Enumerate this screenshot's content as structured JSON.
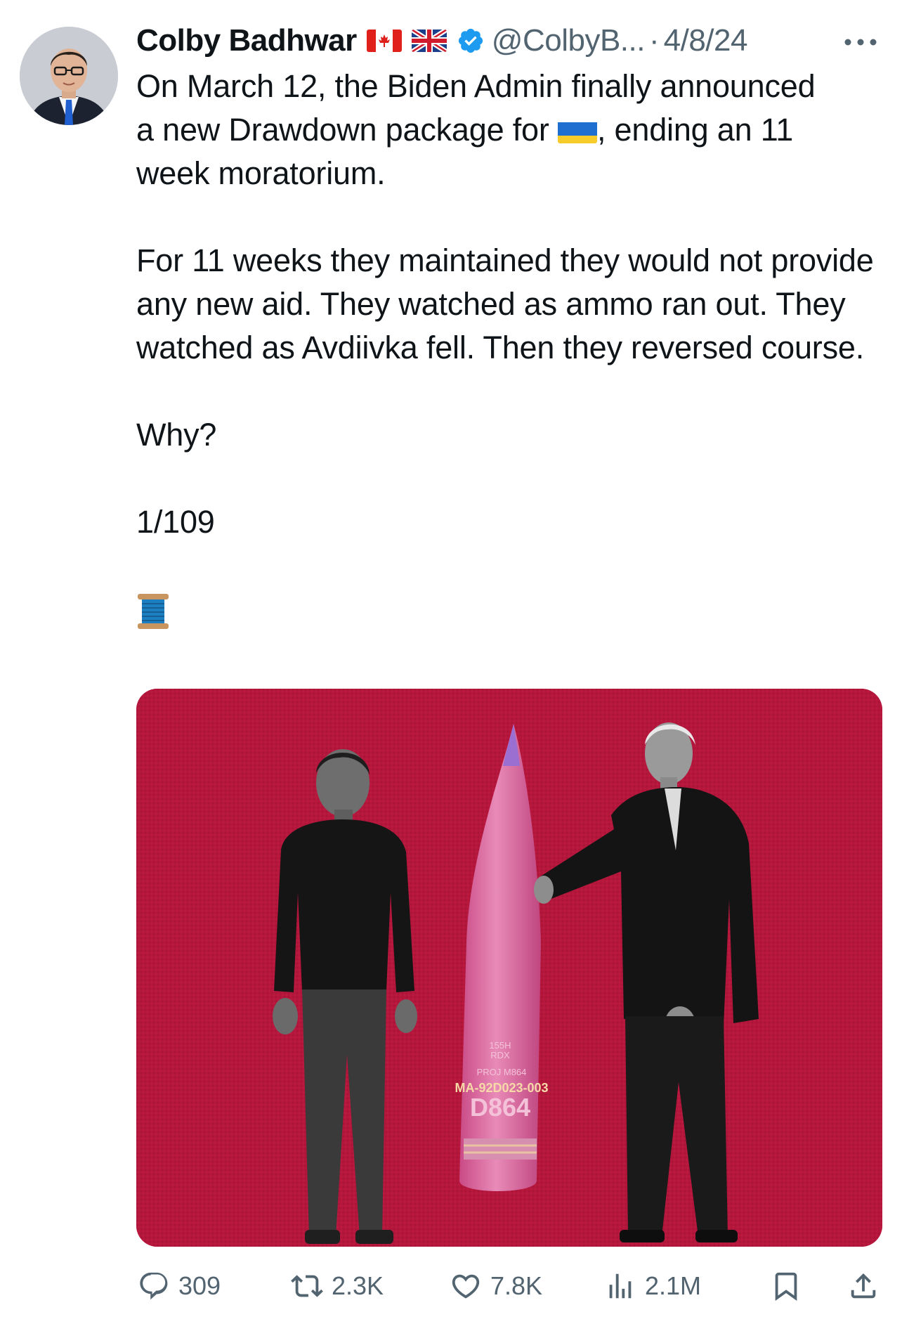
{
  "author": {
    "name": "Colby Badhwar",
    "handle": "@ColbyB...",
    "separator": "·",
    "date": "4/8/24"
  },
  "tweet": {
    "line1": "On March 12, the Biden Admin finally announced",
    "line2a": "a new Drawdown package for ",
    "line2b": ", ending an 11",
    "line3": "week moratorium.",
    "para2": "For 11 weeks they maintained they would not provide any new aid. They watched as ammo ran out. They watched as Avdiivka fell. Then they reversed course.",
    "para3": "Why?",
    "para4": "1/109"
  },
  "media": {
    "shell_lines": [
      "155H",
      "RDX",
      "PROJ M864",
      "MA-92D023-003",
      "D864"
    ]
  },
  "actions": {
    "replies": "309",
    "reposts": "2.3K",
    "likes": "7.8K",
    "views": "2.1M"
  },
  "icons": {
    "verified": "verified-badge-icon",
    "more": "more-options-icon",
    "reply": "reply-icon",
    "repost": "repost-icon",
    "like": "heart-icon",
    "views": "views-chart-icon",
    "bookmark": "bookmark-icon",
    "share": "share-icon",
    "thread": "spool-of-thread-icon"
  },
  "colors": {
    "verified_blue": "#1d9bf0",
    "secondary_text": "#536471",
    "primary_text": "#0f1419",
    "media_background": "#b5173c"
  }
}
